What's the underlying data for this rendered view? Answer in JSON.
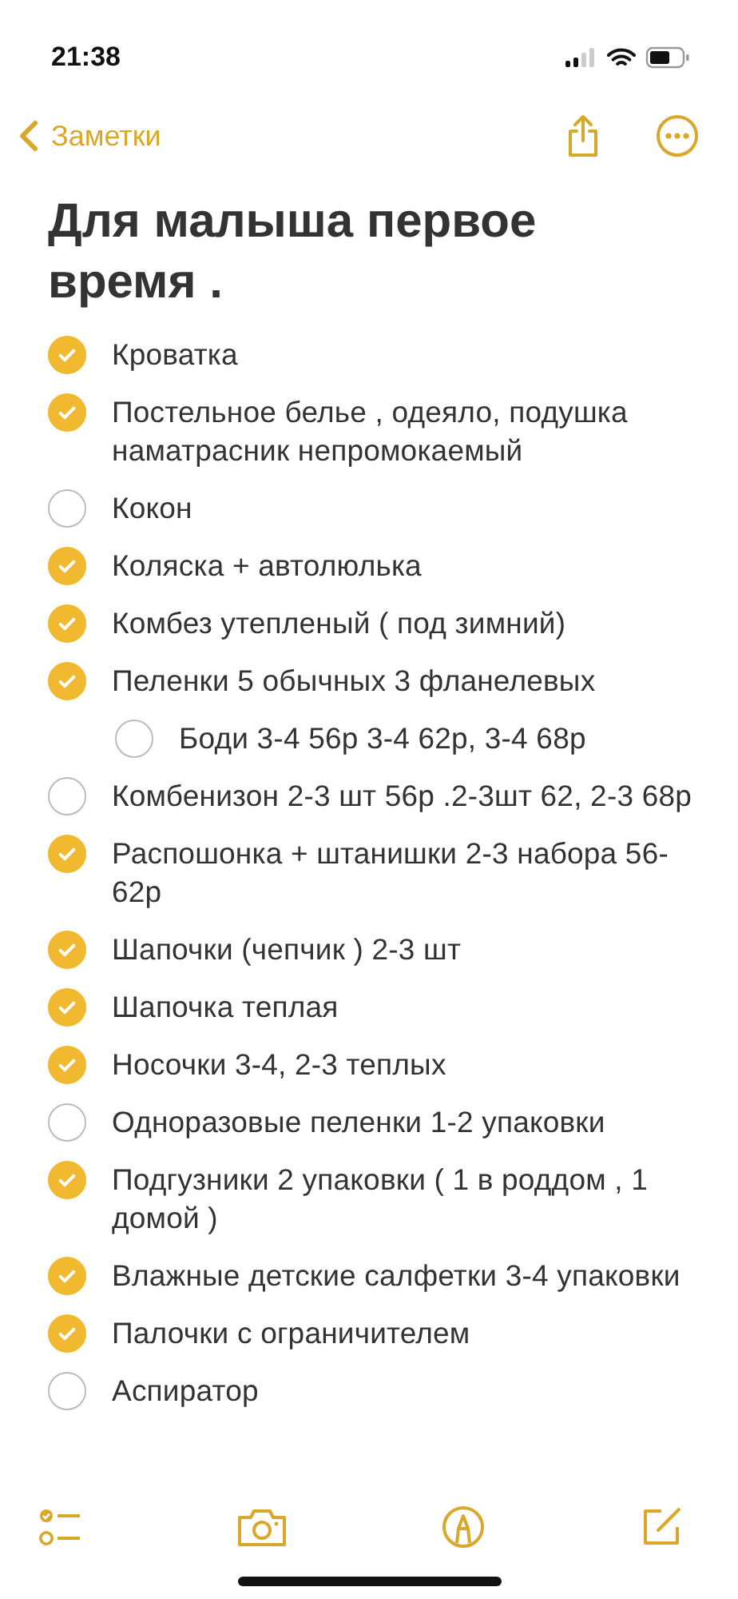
{
  "status_bar": {
    "time": "21:38"
  },
  "nav": {
    "back_label": "Заметки"
  },
  "note": {
    "title": "Для малыша первое время .",
    "items": [
      {
        "text": "Кроватка",
        "checked": true
      },
      {
        "text": "Постельное белье , одеяло, подушка наматрасник непромокаемый",
        "checked": true
      },
      {
        "text": "Кокон",
        "checked": false
      },
      {
        "text": "Коляска + автолюлька",
        "checked": true
      },
      {
        "text": "Комбез утепленый ( под зимний)",
        "checked": true
      },
      {
        "text": "Пеленки 5 обычных 3 фланелевых",
        "checked": true,
        "children": [
          {
            "text": "Боди 3-4 56р 3-4 62р, 3-4 68р",
            "checked": false
          }
        ]
      },
      {
        "text": "Комбенизон 2-3 шт 56р .2-3шт 62, 2-3 68р",
        "checked": false
      },
      {
        "text": "Распошонка + штанишки 2-3 набора 56-62р",
        "checked": true
      },
      {
        "text": "Шапочки (чепчик ) 2-3 шт",
        "checked": true
      },
      {
        "text": "Шапочка теплая",
        "checked": true
      },
      {
        "text": "Носочки 3-4, 2-3 теплых",
        "checked": true
      },
      {
        "text": "Одноразовые пеленки 1-2 упаковки",
        "checked": false
      },
      {
        "text": "Подгузники 2 упаковки ( 1 в роддом , 1 домой )",
        "checked": true
      },
      {
        "text": "Влажные детские салфетки 3-4 упаковки",
        "checked": true
      },
      {
        "text": "Палочки с ограничителем",
        "checked": true
      },
      {
        "text": "Аспиратор",
        "checked": false
      }
    ]
  }
}
